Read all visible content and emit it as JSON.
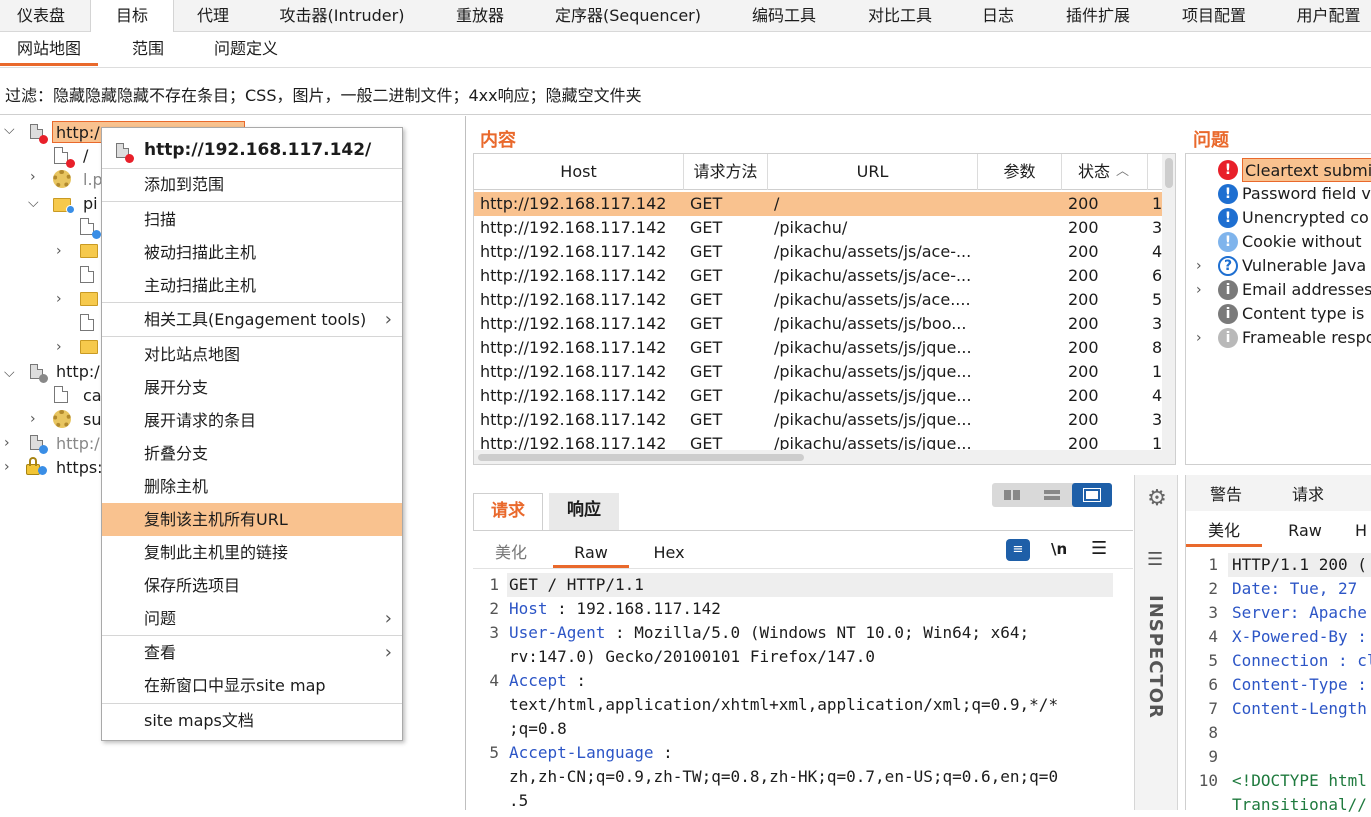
{
  "top_tabs": [
    "仪表盘",
    "目标",
    "代理",
    "攻击器(Intruder)",
    "重放器",
    "定序器(Sequencer)",
    "编码工具",
    "对比工具",
    "日志",
    "插件扩展",
    "项目配置",
    "用户配置"
  ],
  "sub_tabs": [
    "网站地图",
    "范围",
    "问题定义"
  ],
  "filter_text": "过滤：隐藏隐藏隐藏不存在条目；CSS，图片，一般二进制文件；4xx响应；隐藏空文件夹",
  "tree": {
    "host1": "http:/",
    "root_path": "/",
    "l_p": "l.p",
    "pi": "pi",
    "host2": "http:/",
    "ca": "ca",
    "su": "su",
    "host3": "http:/",
    "host4": "https:"
  },
  "context_menu": {
    "header": "http://192.168.117.142/",
    "items": [
      "添加到范围",
      "扫描",
      "被动扫描此主机",
      "主动扫描此主机",
      "相关工具(Engagement tools)",
      "对比站点地图",
      "展开分支",
      "展开请求的条目",
      "折叠分支",
      "删除主机",
      "复制该主机所有URL",
      "复制此主机里的链接",
      "保存所选项目",
      "问题",
      "查看",
      "在新窗口中显示site map",
      "site maps文档"
    ]
  },
  "content": {
    "title": "内容",
    "columns": [
      "Host",
      "请求方法",
      "URL",
      "参数",
      "状态"
    ],
    "rows": [
      {
        "host": "http://192.168.117.142",
        "method": "GET",
        "url": "/",
        "status": "200",
        "extra": "1"
      },
      {
        "host": "http://192.168.117.142",
        "method": "GET",
        "url": "/pikachu/",
        "status": "200",
        "extra": "3"
      },
      {
        "host": "http://192.168.117.142",
        "method": "GET",
        "url": "/pikachu/assets/js/ace-...",
        "status": "200",
        "extra": "4"
      },
      {
        "host": "http://192.168.117.142",
        "method": "GET",
        "url": "/pikachu/assets/js/ace-...",
        "status": "200",
        "extra": "6"
      },
      {
        "host": "http://192.168.117.142",
        "method": "GET",
        "url": "/pikachu/assets/js/ace....",
        "status": "200",
        "extra": "5"
      },
      {
        "host": "http://192.168.117.142",
        "method": "GET",
        "url": "/pikachu/assets/js/boo...",
        "status": "200",
        "extra": "3"
      },
      {
        "host": "http://192.168.117.142",
        "method": "GET",
        "url": "/pikachu/assets/js/jque...",
        "status": "200",
        "extra": "8"
      },
      {
        "host": "http://192.168.117.142",
        "method": "GET",
        "url": "/pikachu/assets/js/jque...",
        "status": "200",
        "extra": "1"
      },
      {
        "host": "http://192.168.117.142",
        "method": "GET",
        "url": "/pikachu/assets/js/jque...",
        "status": "200",
        "extra": "4"
      },
      {
        "host": "http://192.168.117.142",
        "method": "GET",
        "url": "/pikachu/assets/js/jque...",
        "status": "200",
        "extra": "3"
      },
      {
        "host": "http://192.168.117.142",
        "method": "GET",
        "url": "/pikachu/assets/js/jque...",
        "status": "200",
        "extra": "1"
      }
    ]
  },
  "issues": {
    "title": "问题",
    "items": [
      {
        "label": "Cleartext submi",
        "severity": "high"
      },
      {
        "label": "Password field v",
        "severity": "info-blue"
      },
      {
        "label": "Unencrypted co",
        "severity": "info-blue"
      },
      {
        "label": "Cookie without",
        "severity": "info-light"
      },
      {
        "label": "Vulnerable Java",
        "severity": "question"
      },
      {
        "label": "Email addresses",
        "severity": "gray"
      },
      {
        "label": "Content type is",
        "severity": "gray"
      },
      {
        "label": "Frameable respo",
        "severity": "gray-light"
      }
    ]
  },
  "request": {
    "tabs": [
      "请求",
      "响应"
    ],
    "view_tabs": [
      "美化",
      "Raw",
      "Hex"
    ],
    "newline_label": "\\n",
    "lines": [
      {
        "n": "1",
        "key": "",
        "val": "GET / HTTP/1.1"
      },
      {
        "n": "2",
        "key": "Host",
        "val": " 192.168.117.142"
      },
      {
        "n": "3",
        "key": "User-Agent",
        "val": " Mozilla/5.0 (Windows NT 10.0; Win64; x64;"
      },
      {
        "n": "",
        "key": "",
        "val": "rv:147.0) Gecko/20100101 Firefox/147.0"
      },
      {
        "n": "4",
        "key": "Accept",
        "val": ""
      },
      {
        "n": "",
        "key": "",
        "val": "text/html,application/xhtml+xml,application/xml;q=0.9,*/*"
      },
      {
        "n": "",
        "key": "",
        "val": ";q=0.8"
      },
      {
        "n": "5",
        "key": "Accept-Language",
        "val": ""
      },
      {
        "n": "",
        "key": "",
        "val": "zh,zh-CN;q=0.9,zh-TW;q=0.8,zh-HK;q=0.7,en-US;q=0.6,en;q=0"
      },
      {
        "n": "",
        "key": "",
        "val": ".5"
      }
    ]
  },
  "inspector_label": "INSPECTOR",
  "response": {
    "tabs": [
      "警告",
      "请求"
    ],
    "view_tabs": [
      "美化",
      "Raw",
      "H"
    ],
    "lines": [
      {
        "n": "1",
        "text": "HTTP/1.1 200 (",
        "kind": "plain"
      },
      {
        "n": "2",
        "text": "Date: Tue, 27",
        "kind": "kv"
      },
      {
        "n": "3",
        "text": "Server: Apache",
        "kind": "kv"
      },
      {
        "n": "4",
        "text": "X-Powered-By :",
        "kind": "kv"
      },
      {
        "n": "5",
        "text": "Connection : cl",
        "kind": "kv"
      },
      {
        "n": "6",
        "text": "Content-Type :",
        "kind": "kv"
      },
      {
        "n": "7",
        "text": "Content-Length",
        "kind": "kv"
      },
      {
        "n": "8",
        "text": "",
        "kind": "plain"
      },
      {
        "n": "9",
        "text": "",
        "kind": "plain"
      },
      {
        "n": "10",
        "text": "<!DOCTYPE html",
        "kind": "tag"
      },
      {
        "n": "",
        "text": "Transitional//",
        "kind": "tag"
      }
    ]
  },
  "colors": {
    "accent": "#e9692c",
    "selected_row": "#f9c28f",
    "header_key": "#2c55c6",
    "tag": "#1f7a3e"
  }
}
